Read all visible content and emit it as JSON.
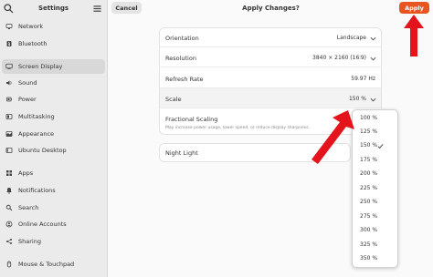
{
  "sidebar": {
    "title": "Settings",
    "items": [
      {
        "label": "Network",
        "icon": "network-icon"
      },
      {
        "label": "Bluetooth",
        "icon": "bluetooth-icon"
      },
      {
        "label": "Screen Display",
        "icon": "display-icon"
      },
      {
        "label": "Sound",
        "icon": "sound-icon"
      },
      {
        "label": "Power",
        "icon": "power-icon"
      },
      {
        "label": "Multitasking",
        "icon": "multitasking-icon"
      },
      {
        "label": "Appearance",
        "icon": "appearance-icon"
      },
      {
        "label": "Ubuntu Desktop",
        "icon": "desktop-icon"
      },
      {
        "label": "Apps",
        "icon": "apps-icon"
      },
      {
        "label": "Notifications",
        "icon": "bell-icon"
      },
      {
        "label": "Search",
        "icon": "search-icon"
      },
      {
        "label": "Online Accounts",
        "icon": "accounts-icon"
      },
      {
        "label": "Sharing",
        "icon": "share-icon"
      },
      {
        "label": "Mouse & Touchpad",
        "icon": "mouse-icon"
      }
    ],
    "active": "Screen Display"
  },
  "header": {
    "cancel_label": "Cancel",
    "title": "Apply Changes?",
    "apply_label": "Apply"
  },
  "display": {
    "orientation_label": "Orientation",
    "orientation_value": "Landscape",
    "resolution_label": "Resolution",
    "resolution_value": "3840 × 2160 (16∶9)",
    "refresh_label": "Refresh Rate",
    "refresh_value": "59.97 Hz",
    "scale_label": "Scale",
    "scale_value": "150 %",
    "fractional_label": "Fractional Scaling",
    "fractional_sub": "May increase power usage, lower speed, or reduce display sharpness.",
    "night_light_label": "Night Light"
  },
  "scale_options": {
    "selected": "150 %",
    "items": [
      "100 %",
      "125 %",
      "150 %",
      "175 %",
      "200 %",
      "225 %",
      "250 %",
      "275 %",
      "300 %",
      "325 %",
      "350 %"
    ]
  },
  "colors": {
    "accent": "#e95420",
    "annotation_arrow": "#e3141b"
  }
}
